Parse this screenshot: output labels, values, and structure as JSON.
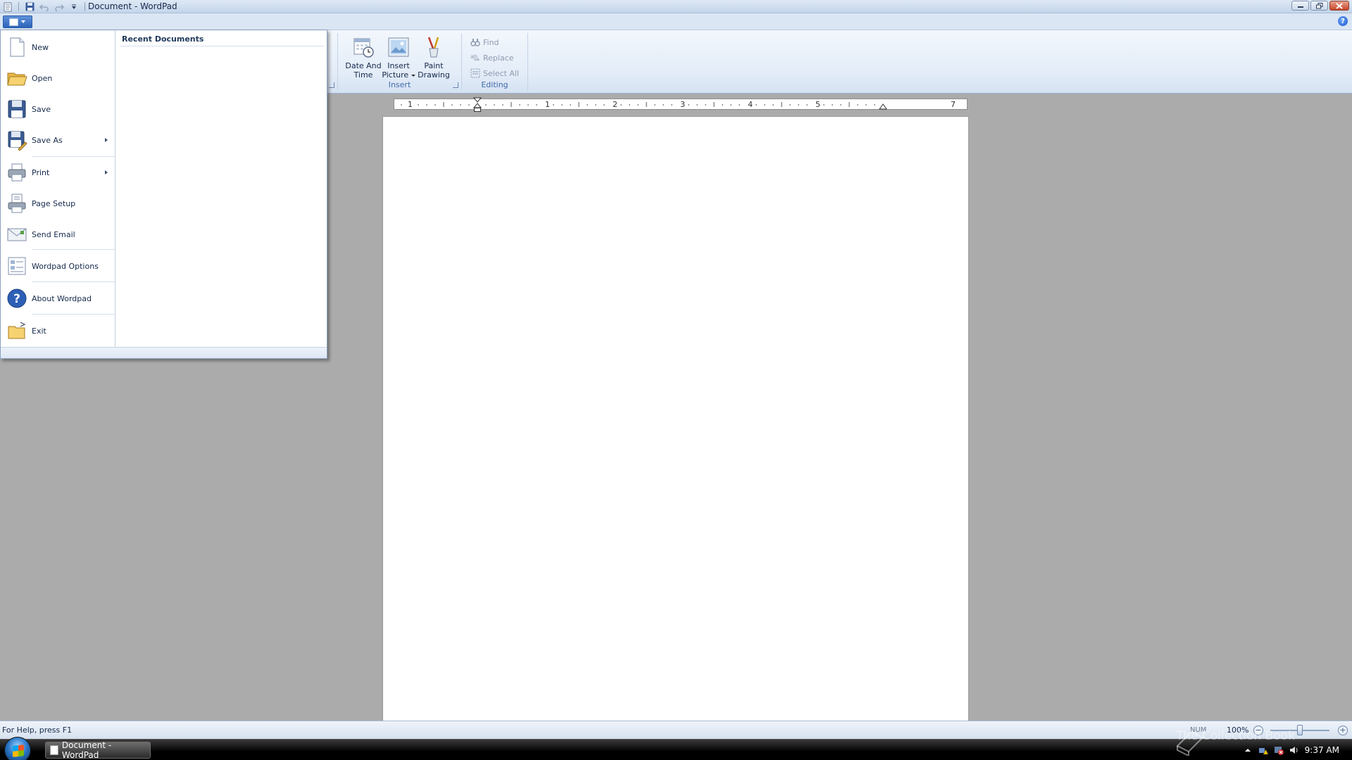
{
  "window": {
    "title": "Document - WordPad"
  },
  "app_menu": {
    "recent_title": "Recent Documents",
    "items": [
      {
        "label": "New",
        "icon": "new-document-icon",
        "submenu": false
      },
      {
        "label": "Open",
        "icon": "folder-open-icon",
        "submenu": false
      },
      {
        "label": "Save",
        "icon": "floppy-disk-icon",
        "submenu": false
      },
      {
        "label": "Save As",
        "icon": "save-as-icon",
        "submenu": true
      },
      {
        "label": "Print",
        "icon": "printer-icon",
        "submenu": true
      },
      {
        "label": "Page Setup",
        "icon": "page-setup-icon",
        "submenu": false
      },
      {
        "label": "Send Email",
        "icon": "email-icon",
        "submenu": false
      },
      {
        "label": "Wordpad Options",
        "icon": "options-icon",
        "submenu": false
      },
      {
        "label": "About Wordpad",
        "icon": "help-icon",
        "submenu": false
      },
      {
        "label": "Exit",
        "icon": "exit-folder-icon",
        "submenu": false
      }
    ]
  },
  "ribbon": {
    "insert_group": {
      "label": "Insert",
      "date_time_line1": "Date And",
      "date_time_line2": "Time",
      "insert_picture_line1": "Insert",
      "insert_picture_line2": "Picture",
      "paint_line1": "Paint",
      "paint_line2": "Drawing"
    },
    "editing_group": {
      "label": "Editing",
      "find": "Find",
      "replace": "Replace",
      "select_all": "Select All"
    }
  },
  "ruler": {
    "numbers": [
      "1",
      "1",
      "2",
      "3",
      "4",
      "5",
      "7"
    ]
  },
  "status": {
    "help_text": "For Help, press F1",
    "num": "NUM",
    "zoom": "100%",
    "zoom_fraction": 0.5
  },
  "taskbar": {
    "task_label": "Document - WordPad",
    "clock": "9:37 AM",
    "watermark": "The Collection Book"
  },
  "colors": {
    "accent": "#2b63b8",
    "ribbon_bg": "#e3ecf8",
    "workspace": "#ababab"
  }
}
